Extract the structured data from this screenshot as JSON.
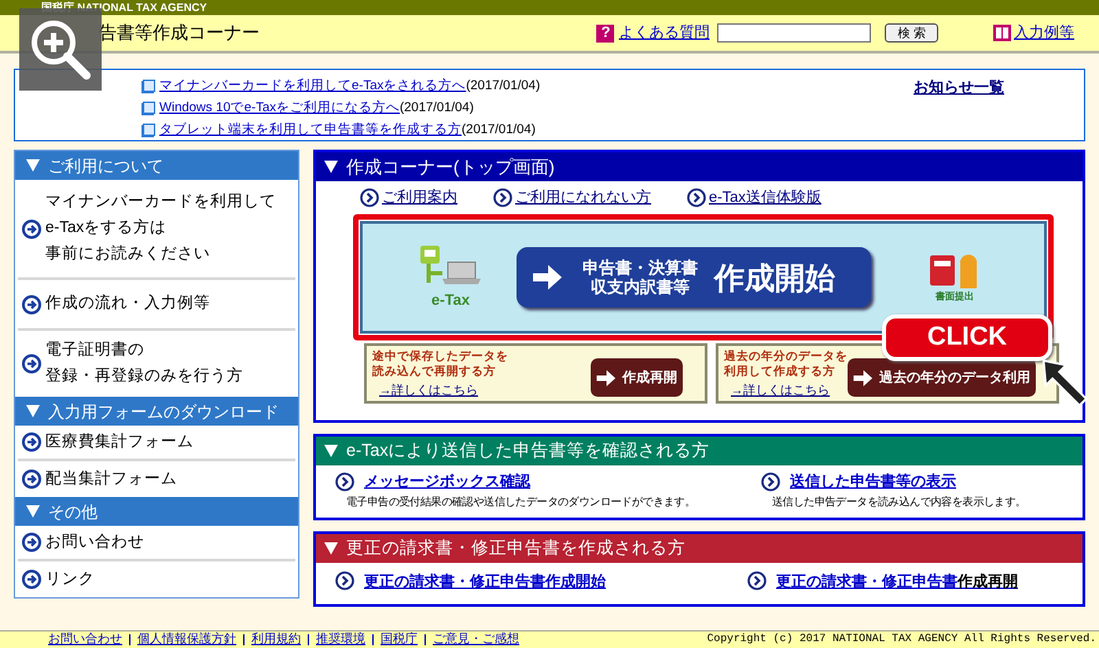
{
  "agency_bar": {
    "label": "国税庁 NATIONAL TAX AGENCY"
  },
  "header": {
    "title": "告書等作成コーナー",
    "faq_icon": "?",
    "faq_link": "よくある質問",
    "search_button": "検 索",
    "examples_link": "入力例等"
  },
  "news": {
    "items": [
      {
        "link": "マイナンバーカードを利用してe-Taxをされる方へ",
        "date": "(2017/01/04)"
      },
      {
        "link": "Windows 10でe-Taxをご利用になる方へ",
        "date": "(2017/01/04)"
      },
      {
        "link": "タブレット端末を利用して申告書等を作成する方",
        "date": "(2017/01/04)"
      }
    ],
    "all_link": "お知らせ一覧"
  },
  "sidebar": {
    "sections": [
      {
        "title": "ご利用について",
        "items": [
          {
            "lines": [
              "マイナンバーカードを利用して",
              "e-Taxをする方は",
              "事前にお読みください"
            ]
          },
          {
            "lines": [
              "作成の流れ・入力例等"
            ]
          },
          {
            "lines": [
              "電子証明書の",
              "登録・再登録のみを行う方"
            ]
          }
        ]
      },
      {
        "title": "入力用フォームのダウンロード",
        "items": [
          {
            "lines": [
              "医療費集計フォーム"
            ]
          },
          {
            "lines": [
              "配当集計フォーム"
            ]
          }
        ]
      },
      {
        "title": "その他",
        "items": [
          {
            "lines": [
              "お問い合わせ"
            ]
          },
          {
            "lines": [
              "リンク"
            ]
          }
        ]
      }
    ]
  },
  "creation_corner": {
    "title": "作成コーナー(トップ画面)",
    "links": [
      "ご利用案内",
      "ご利用になれない方",
      "e-Tax送信体験版"
    ],
    "start_banner": {
      "etax_label": "e-Tax",
      "button_line_1": "申告書・決算書",
      "button_line_2": "収支内訳書等",
      "button_main": "作成開始",
      "paper_label": "書面提出"
    },
    "sub_boxes": [
      {
        "description_lines": [
          "途中で保存したデータを",
          "読み込んで再開する方"
        ],
        "button": "作成再開",
        "details_link": "→詳しくはこちら"
      },
      {
        "description_lines": [
          "過去の年分のデータを",
          "利用して作成する方"
        ],
        "button": "過去の年分のデータ利用",
        "details_link": "→詳しくはこちら"
      }
    ],
    "click_badge": "CLICK"
  },
  "sections": [
    {
      "kind": "described",
      "color": "#008060",
      "title": "e-Taxにより送信した申告書等を確認される方",
      "items": [
        {
          "link": "メッセージボックス確認",
          "description": "電子申告の受付結果の確認や送信したデータのダウンロードができます。"
        },
        {
          "link": "送信した申告書等の表示",
          "description": "送信した申告データを読み込んで内容を表示します。"
        }
      ]
    },
    {
      "kind": "plain",
      "color": "#b82232",
      "title": "更正の請求書・修正申告書を作成される方",
      "items": [
        {
          "link": "更正の請求書・修正申告書作成開始"
        },
        {
          "link": "更正の請求書・修正申告書",
          "suffix": "作成再開"
        }
      ]
    }
  ],
  "footer": {
    "links": [
      "お問い合わせ",
      "個人情報保護方針",
      "利用規約",
      "推奨環境",
      "国税庁",
      "ご意見・ご感想"
    ],
    "copyright": "Copyright (c) 2017 NATIONAL TAX AGENCY All Rights Reserved."
  }
}
